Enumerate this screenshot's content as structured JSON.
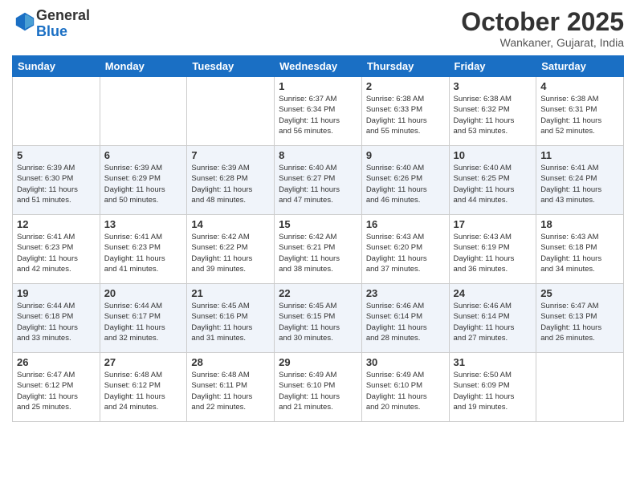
{
  "logo": {
    "general": "General",
    "blue": "Blue"
  },
  "header": {
    "month": "October 2025",
    "location": "Wankaner, Gujarat, India"
  },
  "weekdays": [
    "Sunday",
    "Monday",
    "Tuesday",
    "Wednesday",
    "Thursday",
    "Friday",
    "Saturday"
  ],
  "weeks": [
    [
      {
        "day": "",
        "info": ""
      },
      {
        "day": "",
        "info": ""
      },
      {
        "day": "",
        "info": ""
      },
      {
        "day": "1",
        "info": "Sunrise: 6:37 AM\nSunset: 6:34 PM\nDaylight: 11 hours\nand 56 minutes."
      },
      {
        "day": "2",
        "info": "Sunrise: 6:38 AM\nSunset: 6:33 PM\nDaylight: 11 hours\nand 55 minutes."
      },
      {
        "day": "3",
        "info": "Sunrise: 6:38 AM\nSunset: 6:32 PM\nDaylight: 11 hours\nand 53 minutes."
      },
      {
        "day": "4",
        "info": "Sunrise: 6:38 AM\nSunset: 6:31 PM\nDaylight: 11 hours\nand 52 minutes."
      }
    ],
    [
      {
        "day": "5",
        "info": "Sunrise: 6:39 AM\nSunset: 6:30 PM\nDaylight: 11 hours\nand 51 minutes."
      },
      {
        "day": "6",
        "info": "Sunrise: 6:39 AM\nSunset: 6:29 PM\nDaylight: 11 hours\nand 50 minutes."
      },
      {
        "day": "7",
        "info": "Sunrise: 6:39 AM\nSunset: 6:28 PM\nDaylight: 11 hours\nand 48 minutes."
      },
      {
        "day": "8",
        "info": "Sunrise: 6:40 AM\nSunset: 6:27 PM\nDaylight: 11 hours\nand 47 minutes."
      },
      {
        "day": "9",
        "info": "Sunrise: 6:40 AM\nSunset: 6:26 PM\nDaylight: 11 hours\nand 46 minutes."
      },
      {
        "day": "10",
        "info": "Sunrise: 6:40 AM\nSunset: 6:25 PM\nDaylight: 11 hours\nand 44 minutes."
      },
      {
        "day": "11",
        "info": "Sunrise: 6:41 AM\nSunset: 6:24 PM\nDaylight: 11 hours\nand 43 minutes."
      }
    ],
    [
      {
        "day": "12",
        "info": "Sunrise: 6:41 AM\nSunset: 6:23 PM\nDaylight: 11 hours\nand 42 minutes."
      },
      {
        "day": "13",
        "info": "Sunrise: 6:41 AM\nSunset: 6:23 PM\nDaylight: 11 hours\nand 41 minutes."
      },
      {
        "day": "14",
        "info": "Sunrise: 6:42 AM\nSunset: 6:22 PM\nDaylight: 11 hours\nand 39 minutes."
      },
      {
        "day": "15",
        "info": "Sunrise: 6:42 AM\nSunset: 6:21 PM\nDaylight: 11 hours\nand 38 minutes."
      },
      {
        "day": "16",
        "info": "Sunrise: 6:43 AM\nSunset: 6:20 PM\nDaylight: 11 hours\nand 37 minutes."
      },
      {
        "day": "17",
        "info": "Sunrise: 6:43 AM\nSunset: 6:19 PM\nDaylight: 11 hours\nand 36 minutes."
      },
      {
        "day": "18",
        "info": "Sunrise: 6:43 AM\nSunset: 6:18 PM\nDaylight: 11 hours\nand 34 minutes."
      }
    ],
    [
      {
        "day": "19",
        "info": "Sunrise: 6:44 AM\nSunset: 6:18 PM\nDaylight: 11 hours\nand 33 minutes."
      },
      {
        "day": "20",
        "info": "Sunrise: 6:44 AM\nSunset: 6:17 PM\nDaylight: 11 hours\nand 32 minutes."
      },
      {
        "day": "21",
        "info": "Sunrise: 6:45 AM\nSunset: 6:16 PM\nDaylight: 11 hours\nand 31 minutes."
      },
      {
        "day": "22",
        "info": "Sunrise: 6:45 AM\nSunset: 6:15 PM\nDaylight: 11 hours\nand 30 minutes."
      },
      {
        "day": "23",
        "info": "Sunrise: 6:46 AM\nSunset: 6:14 PM\nDaylight: 11 hours\nand 28 minutes."
      },
      {
        "day": "24",
        "info": "Sunrise: 6:46 AM\nSunset: 6:14 PM\nDaylight: 11 hours\nand 27 minutes."
      },
      {
        "day": "25",
        "info": "Sunrise: 6:47 AM\nSunset: 6:13 PM\nDaylight: 11 hours\nand 26 minutes."
      }
    ],
    [
      {
        "day": "26",
        "info": "Sunrise: 6:47 AM\nSunset: 6:12 PM\nDaylight: 11 hours\nand 25 minutes."
      },
      {
        "day": "27",
        "info": "Sunrise: 6:48 AM\nSunset: 6:12 PM\nDaylight: 11 hours\nand 24 minutes."
      },
      {
        "day": "28",
        "info": "Sunrise: 6:48 AM\nSunset: 6:11 PM\nDaylight: 11 hours\nand 22 minutes."
      },
      {
        "day": "29",
        "info": "Sunrise: 6:49 AM\nSunset: 6:10 PM\nDaylight: 11 hours\nand 21 minutes."
      },
      {
        "day": "30",
        "info": "Sunrise: 6:49 AM\nSunset: 6:10 PM\nDaylight: 11 hours\nand 20 minutes."
      },
      {
        "day": "31",
        "info": "Sunrise: 6:50 AM\nSunset: 6:09 PM\nDaylight: 11 hours\nand 19 minutes."
      },
      {
        "day": "",
        "info": ""
      }
    ]
  ]
}
